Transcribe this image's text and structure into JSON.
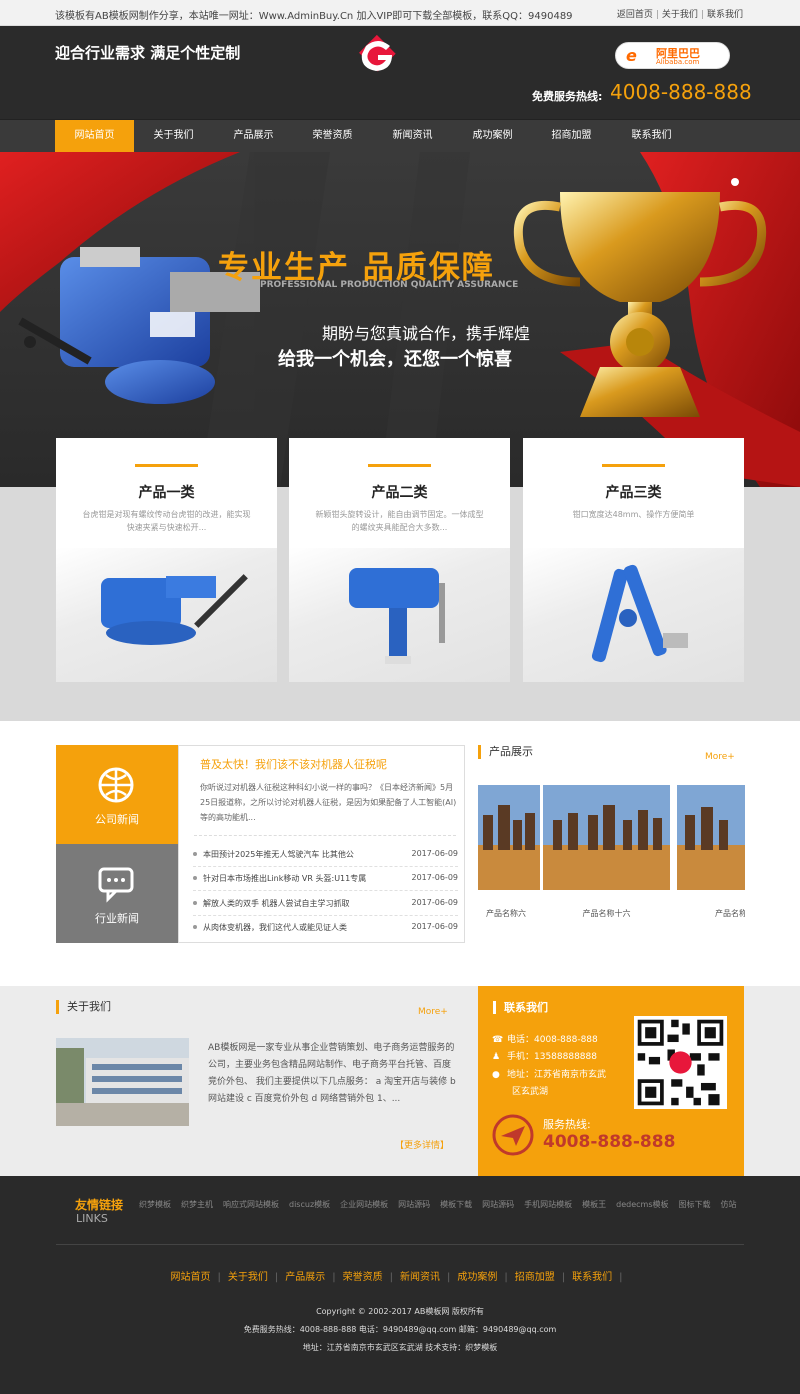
{
  "topbar": {
    "notice": "该模板有AB模板网制作分享，本站唯一网址：Www.AdminBuy.Cn 加入VIP即可下载全部模板，联系QQ：9490489",
    "links": [
      "返回首页",
      "关于我们",
      "联系我们"
    ]
  },
  "header": {
    "slogan": "迎合行业需求 满足个性定制",
    "alibaba_cn": "阿里巴巴",
    "alibaba_en": "Alibaba.com",
    "alibaba_mark": "e",
    "hotline_label": "免费服务热线:",
    "hotline_number": "4008-888-888"
  },
  "nav": [
    "网站首页",
    "关于我们",
    "产品展示",
    "荣誉资质",
    "新闻资讯",
    "成功案例",
    "招商加盟",
    "联系我们"
  ],
  "banner": {
    "title": "专业生产  品质保障",
    "subtitle": "PROFESSIONAL PRODUCTION QUALITY ASSURANCE",
    "line1": "期盼与您真诚合作，携手辉煌",
    "line2": "给我一个机会，还您一个惊喜"
  },
  "products": [
    {
      "name": "产品一类",
      "desc": "台虎钳是对现有螺纹传动台虎钳的改进，能实现快速夹紧与快速松开..."
    },
    {
      "name": "产品二类",
      "desc": "新颖钳头旋转设计，能自由调节固定。一体成型的螺纹夹具能配合大多数..."
    },
    {
      "name": "产品三类",
      "desc": "钳口宽度达48mm、操作方便简单"
    }
  ],
  "news": {
    "tabs": [
      "公司新闻",
      "行业新闻"
    ],
    "featured_title": "普及太快！我们该不该对机器人征税呢",
    "featured_summary": "你听说过对机器人征税这种科幻小说一样的事吗？《日本经济新闻》5月25日报道称，之所以讨论对机器人征税，是因为如果配备了人工智能(AI)等的高功能机...",
    "items": [
      {
        "title": "本田预计2025年推无人驾驶汽车 比其他公",
        "date": "2017-06-09"
      },
      {
        "title": "针对日本市场推出Link移动 VR 头盔:U11专属",
        "date": "2017-06-09"
      },
      {
        "title": "解放人类的双手 机器人尝试自主学习抓取",
        "date": "2017-06-09"
      },
      {
        "title": "从肉体变机器，我们这代人或能见证人类",
        "date": "2017-06-09"
      }
    ]
  },
  "product_show": {
    "title": "产品展示",
    "more": "More+",
    "items": [
      "产品名称六",
      "产品名称十六",
      "产品名称"
    ]
  },
  "about": {
    "title": "关于我们",
    "more": "More+",
    "text": "AB模板网是一家专业从事企业营销策划、电子商务运营服务的公司，主要业务包含精品网站制作、电子商务平台托管、百度竞价外包、 我们主要提供以下几点服务： a 淘宝开店与装修 b 网站建设 c 百度竞价外包 d 网络营销外包 1、...",
    "detail_link": "【更多详情】"
  },
  "contact": {
    "title": "联系我们",
    "phone": "电话：4008-888-888",
    "mobile": "手机：13588888888",
    "address_line1": "地址：江苏省南京市玄武",
    "address_line2": "区玄武湖",
    "hotline_label": "服务热线:",
    "hotline_number": "4008-888-888"
  },
  "footer": {
    "links_title": "友情链接",
    "links_en": "LINKS",
    "links": [
      "织梦模板",
      "织梦主机",
      "响应式网站模板",
      "discuz模板",
      "企业网站模板",
      "网站源码",
      "模板下载",
      "网站源码",
      "手机网站模板",
      "模板王",
      "dedecms模板",
      "图标下载",
      "仿站"
    ],
    "nav": [
      "网站首页",
      "关于我们",
      "产品展示",
      "荣誉资质",
      "新闻资讯",
      "成功案例",
      "招商加盟",
      "联系我们"
    ],
    "copyright": "Copyright © 2002-2017 AB模板网 版权所有",
    "contact_line": "免费服务热线：4008-888-888 电话：9490489@qq.com 邮箱：9490489@qq.com",
    "address_line": "地址：江苏省南京市玄武区玄武湖 技术支持：织梦模板"
  },
  "colors": {
    "accent": "#f5a10c",
    "dark": "#2b2b2b",
    "gray_tab": "#7a7a7a",
    "hotline_red": "#c0392b"
  }
}
